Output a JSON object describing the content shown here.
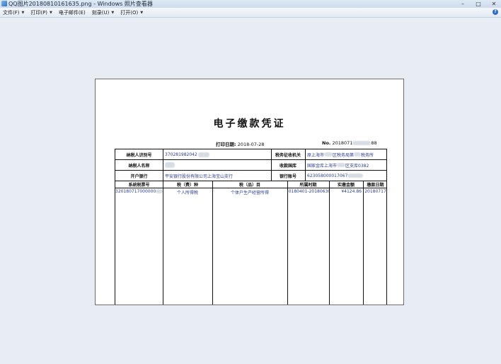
{
  "window": {
    "title": "QQ图片20180810161635.png - Windows 照片查看器",
    "minimize": "–",
    "maximize": "□",
    "close": "✕"
  },
  "menu": {
    "items": [
      {
        "label": "文件(F)"
      },
      {
        "label": "打印(P)"
      },
      {
        "label": "电子邮件(E)"
      },
      {
        "label": "刻录(U)"
      },
      {
        "label": "打开(O)"
      }
    ],
    "help": "?"
  },
  "document": {
    "title": "电子缴款凭证",
    "print_date_label": "打印日期:",
    "print_date": "2018-07-28",
    "no_label": "No.",
    "no_prefix": "2018071",
    "no_suffix": "88",
    "rows": {
      "taxpayer_id_label": "纳税人识别号",
      "taxpayer_id_value": "370281982042",
      "tax_authority_label": "税务征收机关",
      "tax_authority_prefix": "原上海市",
      "tax_authority_mid": "区税务局第",
      "tax_authority_suffix": "税务所",
      "taxpayer_name_label": "纳税人名称",
      "treasury_label": "收款国库",
      "treasury_prefix": "国家金库上海市",
      "treasury_suffix": "区支库0382",
      "bank_label": "开户银行",
      "bank_value": "平安银行股份有限公司上海宝山支行",
      "account_label": "银行账号",
      "account_value": "623058000017067"
    },
    "table": {
      "headers": [
        "系统税票号",
        "税（费）种",
        "税（品）目",
        "所属时期",
        "实缴金额",
        "缴款日期"
      ],
      "row": {
        "ticket_no": "320180717000000",
        "tax_type": "个人所得税",
        "tax_item": "个体户生产经营所得",
        "period": "20180401-20180630",
        "amount": "¥4124.86",
        "pay_date": "20180717"
      }
    }
  }
}
